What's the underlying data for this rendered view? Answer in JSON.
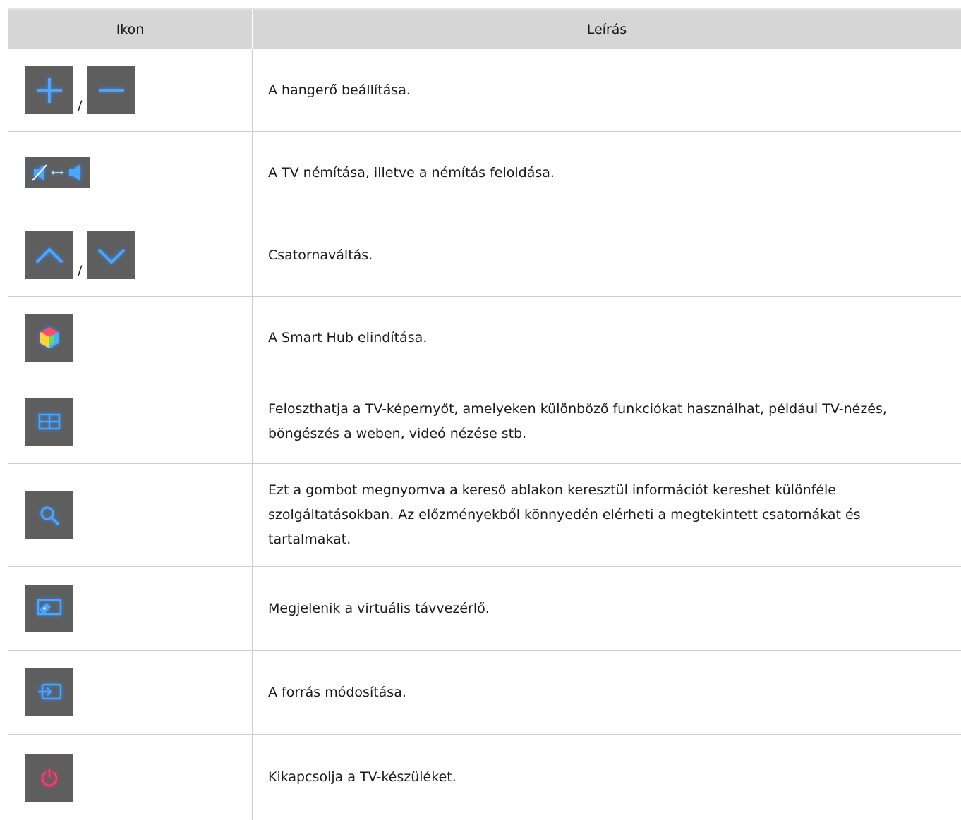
{
  "header": {
    "col_icon": "Ikon",
    "col_desc": "Leírás"
  },
  "separator": "/",
  "rows": [
    {
      "icons": [
        "plus-icon",
        "minus-icon"
      ],
      "description": "A hangerő beállítása."
    },
    {
      "icons": [
        "mute-toggle-icon"
      ],
      "description": "A TV némítása, illetve a némítás feloldása."
    },
    {
      "icons": [
        "chevron-up-icon",
        "chevron-down-icon"
      ],
      "description": "Csatornaváltás."
    },
    {
      "icons": [
        "smart-hub-icon"
      ],
      "description": "A Smart Hub elindítása."
    },
    {
      "icons": [
        "split-screen-icon"
      ],
      "description": "Feloszthatja a TV-képernyőt, amelyeken különböző funkciókat használhat, például TV-nézés, böngészés a weben, videó nézése stb."
    },
    {
      "icons": [
        "search-icon"
      ],
      "description": "Ezt a gombot megnyomva a kereső ablakon keresztül információt kereshet különféle szolgáltatásokban. Az előzményekből könnyedén elérheti a megtekintett csatornákat és tartalmakat."
    },
    {
      "icons": [
        "virtual-remote-icon"
      ],
      "description": "Megjelenik a virtuális távvezérlő."
    },
    {
      "icons": [
        "source-icon"
      ],
      "description": "A forrás módosítása."
    },
    {
      "icons": [
        "power-icon"
      ],
      "description": "Kikapcsolja a TV-készüléket."
    }
  ],
  "colors": {
    "button": "#5e5e5e",
    "accent": "#2f8bff",
    "power": "#ff2a6a",
    "header_bg": "#d6d6d6"
  }
}
